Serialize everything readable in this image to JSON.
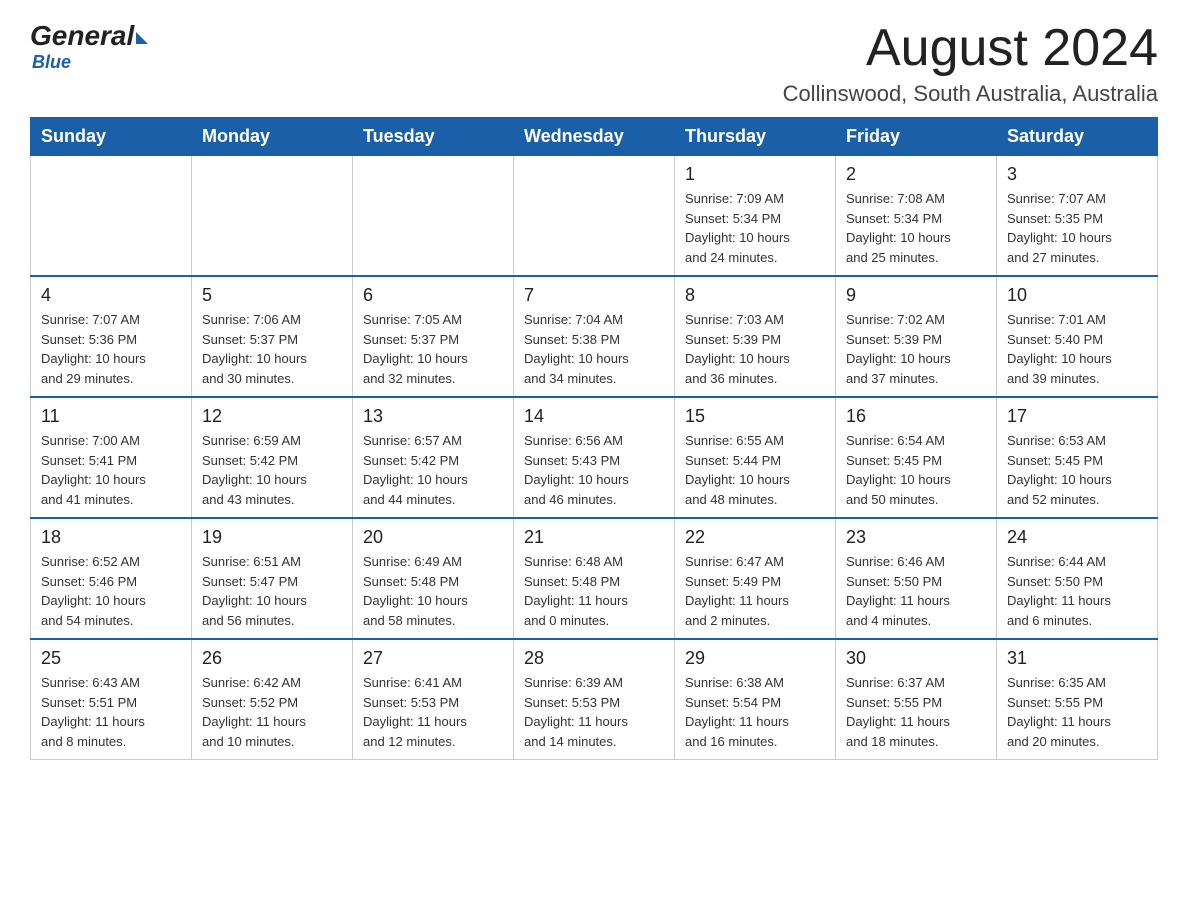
{
  "header": {
    "logo_general": "General",
    "logo_blue": "Blue",
    "month_title": "August 2024",
    "location": "Collinswood, South Australia, Australia"
  },
  "weekdays": [
    "Sunday",
    "Monday",
    "Tuesday",
    "Wednesday",
    "Thursday",
    "Friday",
    "Saturday"
  ],
  "weeks": [
    [
      {
        "day": "",
        "info": ""
      },
      {
        "day": "",
        "info": ""
      },
      {
        "day": "",
        "info": ""
      },
      {
        "day": "",
        "info": ""
      },
      {
        "day": "1",
        "info": "Sunrise: 7:09 AM\nSunset: 5:34 PM\nDaylight: 10 hours\nand 24 minutes."
      },
      {
        "day": "2",
        "info": "Sunrise: 7:08 AM\nSunset: 5:34 PM\nDaylight: 10 hours\nand 25 minutes."
      },
      {
        "day": "3",
        "info": "Sunrise: 7:07 AM\nSunset: 5:35 PM\nDaylight: 10 hours\nand 27 minutes."
      }
    ],
    [
      {
        "day": "4",
        "info": "Sunrise: 7:07 AM\nSunset: 5:36 PM\nDaylight: 10 hours\nand 29 minutes."
      },
      {
        "day": "5",
        "info": "Sunrise: 7:06 AM\nSunset: 5:37 PM\nDaylight: 10 hours\nand 30 minutes."
      },
      {
        "day": "6",
        "info": "Sunrise: 7:05 AM\nSunset: 5:37 PM\nDaylight: 10 hours\nand 32 minutes."
      },
      {
        "day": "7",
        "info": "Sunrise: 7:04 AM\nSunset: 5:38 PM\nDaylight: 10 hours\nand 34 minutes."
      },
      {
        "day": "8",
        "info": "Sunrise: 7:03 AM\nSunset: 5:39 PM\nDaylight: 10 hours\nand 36 minutes."
      },
      {
        "day": "9",
        "info": "Sunrise: 7:02 AM\nSunset: 5:39 PM\nDaylight: 10 hours\nand 37 minutes."
      },
      {
        "day": "10",
        "info": "Sunrise: 7:01 AM\nSunset: 5:40 PM\nDaylight: 10 hours\nand 39 minutes."
      }
    ],
    [
      {
        "day": "11",
        "info": "Sunrise: 7:00 AM\nSunset: 5:41 PM\nDaylight: 10 hours\nand 41 minutes."
      },
      {
        "day": "12",
        "info": "Sunrise: 6:59 AM\nSunset: 5:42 PM\nDaylight: 10 hours\nand 43 minutes."
      },
      {
        "day": "13",
        "info": "Sunrise: 6:57 AM\nSunset: 5:42 PM\nDaylight: 10 hours\nand 44 minutes."
      },
      {
        "day": "14",
        "info": "Sunrise: 6:56 AM\nSunset: 5:43 PM\nDaylight: 10 hours\nand 46 minutes."
      },
      {
        "day": "15",
        "info": "Sunrise: 6:55 AM\nSunset: 5:44 PM\nDaylight: 10 hours\nand 48 minutes."
      },
      {
        "day": "16",
        "info": "Sunrise: 6:54 AM\nSunset: 5:45 PM\nDaylight: 10 hours\nand 50 minutes."
      },
      {
        "day": "17",
        "info": "Sunrise: 6:53 AM\nSunset: 5:45 PM\nDaylight: 10 hours\nand 52 minutes."
      }
    ],
    [
      {
        "day": "18",
        "info": "Sunrise: 6:52 AM\nSunset: 5:46 PM\nDaylight: 10 hours\nand 54 minutes."
      },
      {
        "day": "19",
        "info": "Sunrise: 6:51 AM\nSunset: 5:47 PM\nDaylight: 10 hours\nand 56 minutes."
      },
      {
        "day": "20",
        "info": "Sunrise: 6:49 AM\nSunset: 5:48 PM\nDaylight: 10 hours\nand 58 minutes."
      },
      {
        "day": "21",
        "info": "Sunrise: 6:48 AM\nSunset: 5:48 PM\nDaylight: 11 hours\nand 0 minutes."
      },
      {
        "day": "22",
        "info": "Sunrise: 6:47 AM\nSunset: 5:49 PM\nDaylight: 11 hours\nand 2 minutes."
      },
      {
        "day": "23",
        "info": "Sunrise: 6:46 AM\nSunset: 5:50 PM\nDaylight: 11 hours\nand 4 minutes."
      },
      {
        "day": "24",
        "info": "Sunrise: 6:44 AM\nSunset: 5:50 PM\nDaylight: 11 hours\nand 6 minutes."
      }
    ],
    [
      {
        "day": "25",
        "info": "Sunrise: 6:43 AM\nSunset: 5:51 PM\nDaylight: 11 hours\nand 8 minutes."
      },
      {
        "day": "26",
        "info": "Sunrise: 6:42 AM\nSunset: 5:52 PM\nDaylight: 11 hours\nand 10 minutes."
      },
      {
        "day": "27",
        "info": "Sunrise: 6:41 AM\nSunset: 5:53 PM\nDaylight: 11 hours\nand 12 minutes."
      },
      {
        "day": "28",
        "info": "Sunrise: 6:39 AM\nSunset: 5:53 PM\nDaylight: 11 hours\nand 14 minutes."
      },
      {
        "day": "29",
        "info": "Sunrise: 6:38 AM\nSunset: 5:54 PM\nDaylight: 11 hours\nand 16 minutes."
      },
      {
        "day": "30",
        "info": "Sunrise: 6:37 AM\nSunset: 5:55 PM\nDaylight: 11 hours\nand 18 minutes."
      },
      {
        "day": "31",
        "info": "Sunrise: 6:35 AM\nSunset: 5:55 PM\nDaylight: 11 hours\nand 20 minutes."
      }
    ]
  ]
}
